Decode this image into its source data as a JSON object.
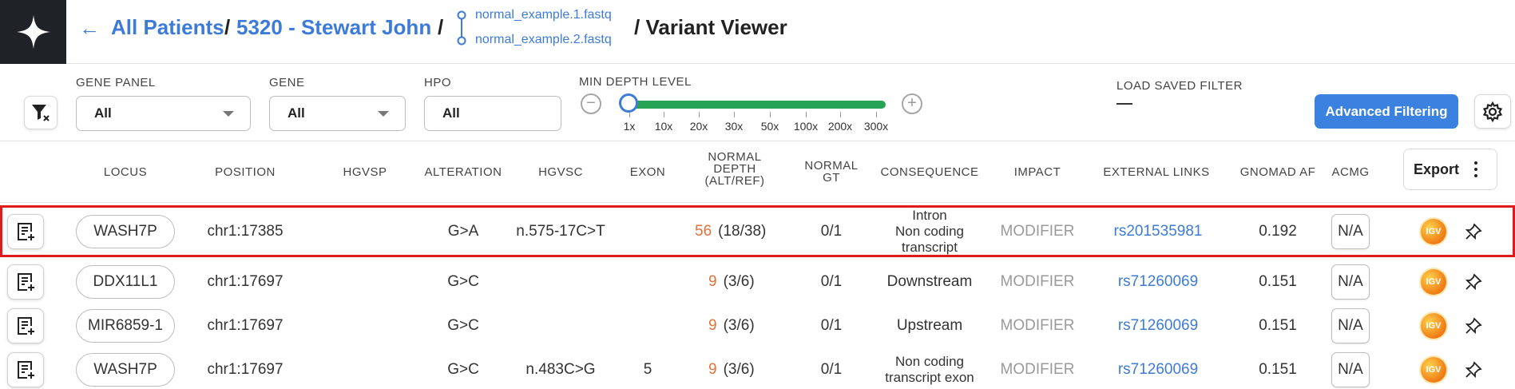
{
  "header": {
    "breadcrumbs": {
      "all_patients": "All Patients",
      "separator": "/",
      "patient": "5320 - Stewart John",
      "fastq_1": "normal_example.1.fastq",
      "fastq_2": "normal_example.2.fastq",
      "page": "/ Variant Viewer"
    },
    "icons": {
      "logo": "star-logo-icon",
      "back": "arrow-left-icon",
      "files": "file-tree-icon"
    }
  },
  "filters": {
    "gene_panel": {
      "label": "GENE PANEL",
      "value": "All"
    },
    "gene": {
      "label": "GENE",
      "value": "All"
    },
    "hpo": {
      "label": "HPO",
      "value": "All"
    },
    "min_depth": {
      "label": "MIN DEPTH LEVEL",
      "ticks": [
        "1x",
        "10x",
        "20x",
        "30x",
        "50x",
        "100x",
        "200x",
        "300x"
      ],
      "selected": "1x",
      "minus": "−",
      "plus": "+"
    },
    "saved_filter": {
      "label": "LOAD SAVED FILTER",
      "value": "—"
    },
    "advanced_button": "Advanced Filtering",
    "icons": {
      "clear": "filter-clear-icon",
      "settings": "gear-icon"
    }
  },
  "table": {
    "columns": {
      "locus": "LOCUS",
      "position": "POSITION",
      "hgvsp": "HGVSP",
      "alteration": "ALTERATION",
      "hgvsc": "HGVSC",
      "exon": "EXON",
      "normal_depth_1": "NORMAL",
      "normal_depth_2": "DEPTH",
      "normal_depth_3": "(ALT/REF)",
      "normal_gt_1": "NORMAL",
      "normal_gt_2": "GT",
      "consequence": "CONSEQUENCE",
      "impact": "IMPACT",
      "external_links": "EXTERNAL LINKS",
      "gnomad_af": "GNOMAD AF",
      "acmg": "ACMG"
    },
    "export_label": "Export",
    "rows": [
      {
        "locus": "WASH7P",
        "position": "chr1:17385",
        "hgvsp": "",
        "alteration": "G>A",
        "hgvsc": "n.575-17C>T",
        "exon": "",
        "depth_alt": "56",
        "depth_ratio": "(18/38)",
        "gt": "0/1",
        "consequence": [
          "Intron",
          "Non coding",
          "transcript"
        ],
        "impact": "MODIFIER",
        "link": "rs201535981",
        "gnomad": "0.192",
        "acmg": "N/A",
        "igv": "IGV",
        "highlighted": true
      },
      {
        "locus": "DDX11L1",
        "position": "chr1:17697",
        "hgvsp": "",
        "alteration": "G>C",
        "hgvsc": "",
        "exon": "",
        "depth_alt": "9",
        "depth_ratio": "(3/6)",
        "gt": "0/1",
        "consequence": [
          "Downstream"
        ],
        "impact": "MODIFIER",
        "link": "rs71260069",
        "gnomad": "0.151",
        "acmg": "N/A",
        "igv": "IGV",
        "highlighted": false
      },
      {
        "locus": "MIR6859-1",
        "position": "chr1:17697",
        "hgvsp": "",
        "alteration": "G>C",
        "hgvsc": "",
        "exon": "",
        "depth_alt": "9",
        "depth_ratio": "(3/6)",
        "gt": "0/1",
        "consequence": [
          "Upstream"
        ],
        "impact": "MODIFIER",
        "link": "rs71260069",
        "gnomad": "0.151",
        "acmg": "N/A",
        "igv": "IGV",
        "highlighted": false
      },
      {
        "locus": "WASH7P",
        "position": "chr1:17697",
        "hgvsp": "",
        "alteration": "G>C",
        "hgvsc": "n.483C>G",
        "exon": "5",
        "depth_alt": "9",
        "depth_ratio": "(3/6)",
        "gt": "0/1",
        "consequence": [
          "Non coding",
          "transcript exon"
        ],
        "impact": "MODIFIER",
        "link": "rs71260069",
        "gnomad": "0.151",
        "acmg": "N/A",
        "igv": "IGV",
        "highlighted": false
      }
    ]
  },
  "colors": {
    "accent": "#3b82e0",
    "link": "#3d7bd9",
    "slider": "#27a356",
    "depth_number": "#e2713a",
    "highlight_outline": "#e01b1b",
    "logo_bg": "#1f2328"
  }
}
